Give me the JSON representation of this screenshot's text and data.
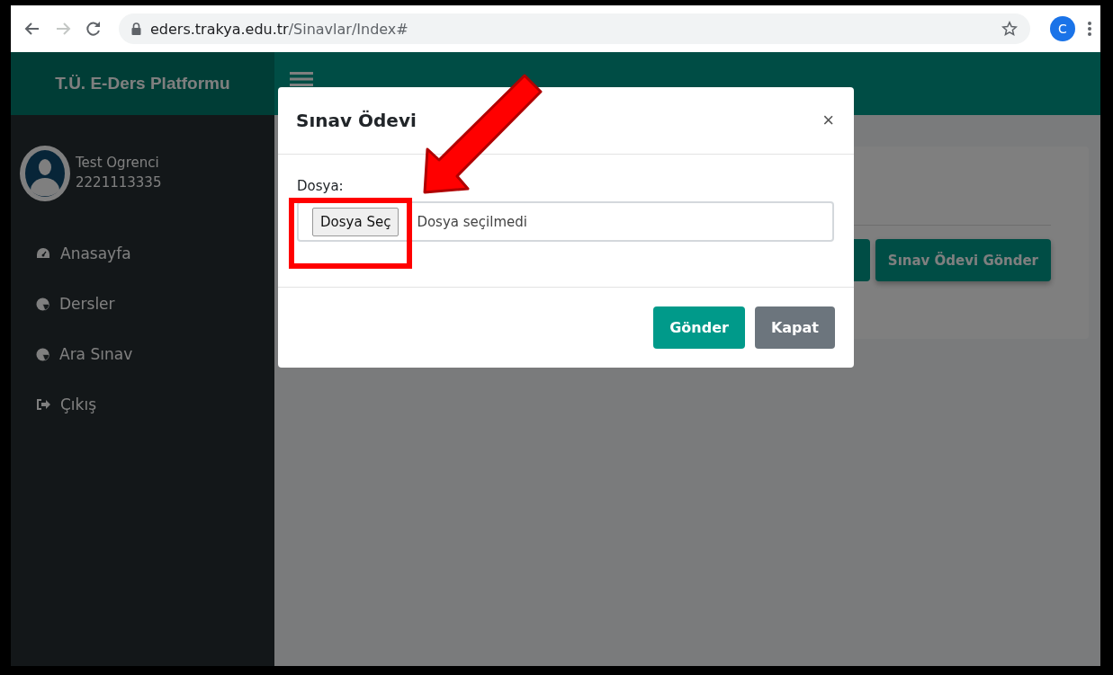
{
  "browser": {
    "url_host": "eders.trakya.edu.tr",
    "url_path": "/Sinavlar/Index#",
    "forward_disabled": true,
    "profile_initial": "C"
  },
  "header": {
    "brand": "T.Ü. E-Ders Platformu"
  },
  "user": {
    "name": "Test Ogrenci",
    "number": "2221113335"
  },
  "sidebar": {
    "items": [
      {
        "label": "Anasayfa",
        "kind": "dashboard"
      },
      {
        "label": "Dersler",
        "kind": "chart"
      },
      {
        "label": "Ara Sınav",
        "kind": "chart"
      },
      {
        "label": "Çıkış",
        "kind": "logout"
      }
    ]
  },
  "page": {
    "buttons": [
      "Sınav Ödevi Gönder"
    ]
  },
  "modal": {
    "title": "Sınav Ödevi",
    "close": "×",
    "field_label": "Dosya:",
    "file_button": "Dosya Seç",
    "file_status": "Dosya seçilmedi",
    "buttons": [
      {
        "label": "Gönder",
        "kind": "primary"
      },
      {
        "label": "Kapat",
        "kind": "secondary"
      }
    ]
  }
}
